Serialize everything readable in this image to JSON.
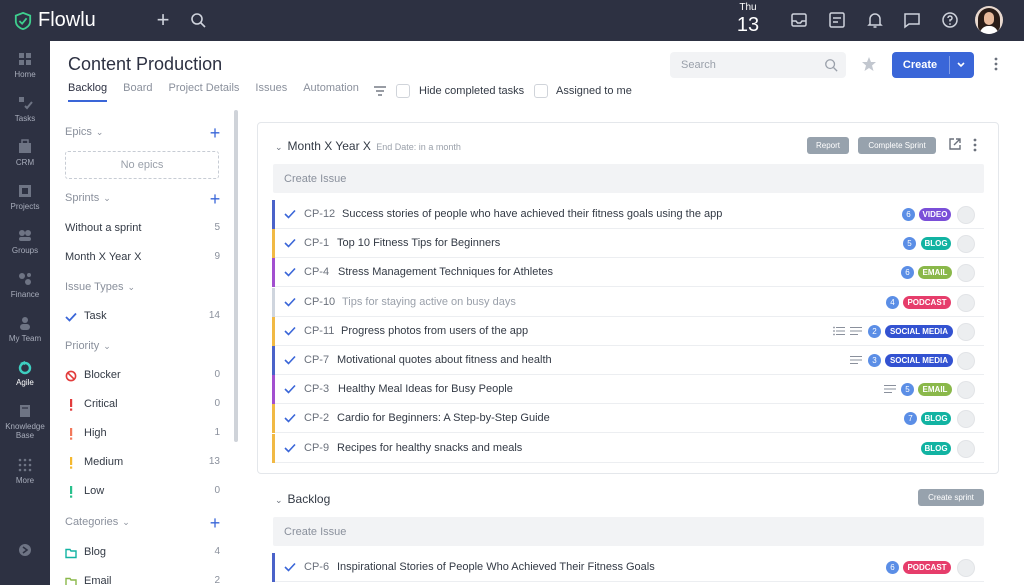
{
  "app": {
    "name": "Flowlu"
  },
  "topbar": {
    "day": "Thu",
    "date": "13"
  },
  "nav": [
    {
      "label": "Home",
      "icon": "home-icon"
    },
    {
      "label": "Tasks",
      "icon": "tasks-icon"
    },
    {
      "label": "CRM",
      "icon": "crm-icon"
    },
    {
      "label": "Projects",
      "icon": "projects-icon"
    },
    {
      "label": "Groups",
      "icon": "groups-icon"
    },
    {
      "label": "Finance",
      "icon": "finance-icon"
    },
    {
      "label": "My Team",
      "icon": "team-icon"
    },
    {
      "label": "Agile",
      "icon": "agile-icon"
    },
    {
      "label": "Knowledge",
      "label2": "Base",
      "icon": "knowledge-base-icon"
    },
    {
      "label": "More",
      "icon": "more-icon"
    }
  ],
  "header": {
    "title": "Content Production",
    "tabs": [
      "Backlog",
      "Board",
      "Project Details",
      "Issues",
      "Automation"
    ],
    "hide_completed": "Hide completed tasks",
    "assigned_to_me": "Assigned to me",
    "search_placeholder": "Search",
    "create_label": "Create"
  },
  "sidebar": {
    "epics": {
      "heading": "Epics",
      "empty": "No epics"
    },
    "sprints": {
      "heading": "Sprints",
      "items": [
        {
          "label": "Without a sprint",
          "count": "5"
        },
        {
          "label": "Month X Year X",
          "count": "9"
        }
      ]
    },
    "issue_types": {
      "heading": "Issue Types",
      "items": [
        {
          "label": "Task",
          "count": "14"
        }
      ]
    },
    "priority": {
      "heading": "Priority",
      "items": [
        {
          "label": "Blocker",
          "count": "0"
        },
        {
          "label": "Critical",
          "count": "0"
        },
        {
          "label": "High",
          "count": "1"
        },
        {
          "label": "Medium",
          "count": "13"
        },
        {
          "label": "Low",
          "count": "0"
        }
      ]
    },
    "categories": {
      "heading": "Categories",
      "items": [
        {
          "label": "Blog",
          "count": "4"
        },
        {
          "label": "Email",
          "count": "2"
        }
      ]
    }
  },
  "sprint": {
    "title": "Month X Year X",
    "end_date": "End Date: in a month",
    "report_label": "Report",
    "complete_label": "Complete Sprint",
    "create_issue": "Create Issue",
    "issues": [
      {
        "code": "CP-12",
        "title": "Success stories of people who have achieved their fitness goals using the app",
        "count": "6",
        "tag": "VIDEO",
        "tag_color": "#7a4fd8",
        "bar_color": "#4a62c9",
        "done": false
      },
      {
        "code": "CP-1",
        "title": "Top 10 Fitness Tips for Beginners",
        "count": "5",
        "tag": "BLOG",
        "tag_color": "#12b3a2",
        "bar_color": "#f1b944",
        "done": false
      },
      {
        "code": "CP-4",
        "title": "Stress Management Techniques for Athletes",
        "count": "6",
        "tag": "EMAIL",
        "tag_color": "#8ab84a",
        "bar_color": "#a24fcf",
        "done": false
      },
      {
        "code": "CP-10",
        "title": "Tips for staying active on busy days",
        "count": "4",
        "tag": "PODCAST",
        "tag_color": "#e63d6b",
        "bar_color": "#cfd5de",
        "done": true
      },
      {
        "code": "CP-11",
        "title": "Progress photos from users of the app",
        "count": "2",
        "tag": "SOCIAL MEDIA",
        "tag_color": "#3352d1",
        "bar_color": "#f1b944",
        "done": false
      },
      {
        "code": "CP-7",
        "title": "Motivational quotes about fitness and health",
        "count": "3",
        "tag": "SOCIAL MEDIA",
        "tag_color": "#3352d1",
        "bar_color": "#4a62c9",
        "done": false
      },
      {
        "code": "CP-3",
        "title": "Healthy Meal Ideas for Busy People",
        "count": "5",
        "tag": "EMAIL",
        "tag_color": "#8ab84a",
        "bar_color": "#a24fcf",
        "done": false
      },
      {
        "code": "CP-2",
        "title": "Cardio for Beginners: A Step-by-Step Guide",
        "count": "7",
        "tag": "BLOG",
        "tag_color": "#12b3a2",
        "bar_color": "#f1b944",
        "done": false
      },
      {
        "code": "CP-9",
        "title": "Recipes for healthy snacks and meals",
        "count": "",
        "tag": "BLOG",
        "tag_color": "#12b3a2",
        "bar_color": "#f1b944",
        "done": false
      }
    ]
  },
  "backlog": {
    "title": "Backlog",
    "create_sprint_label": "Create sprint",
    "create_issue": "Create Issue",
    "issues": [
      {
        "code": "CP-6",
        "title": "Inspirational Stories of People Who Achieved Their Fitness Goals",
        "count": "6",
        "tag": "PODCAST",
        "tag_color": "#e63d6b",
        "bar_color": "#4a62c9"
      }
    ]
  },
  "colors": {
    "topbar": "#2d3142",
    "accent": "#3a66d8"
  }
}
